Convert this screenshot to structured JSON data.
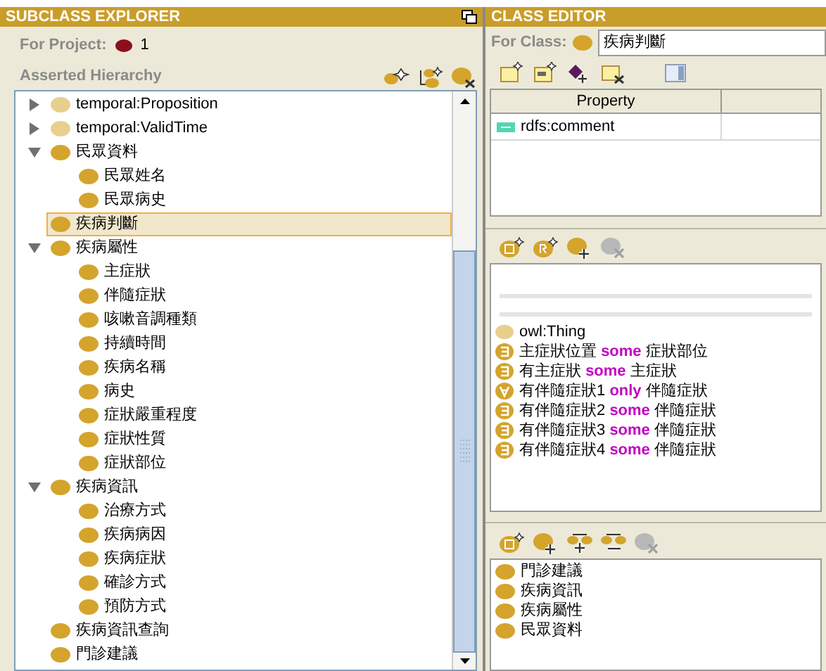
{
  "subclass_explorer": {
    "title": "SUBCLASS EXPLORER",
    "project_label": "For Project:",
    "project_value": "1",
    "hierarchy_label": "Asserted Hierarchy",
    "tree": [
      {
        "label": "temporal:Proposition",
        "color": "#e8cf8e",
        "expanded": false,
        "selected": false
      },
      {
        "label": "temporal:ValidTime",
        "color": "#e8cf8e",
        "expanded": false,
        "selected": false
      },
      {
        "label": "民眾資料",
        "color": "#d4a42c",
        "expanded": true,
        "selected": false,
        "children": [
          {
            "label": "民眾姓名",
            "color": "#d4a42c",
            "selected": false
          },
          {
            "label": "民眾病史",
            "color": "#d4a42c",
            "selected": false
          }
        ]
      },
      {
        "label": "疾病判斷",
        "color": "#d4a42c",
        "selected": true
      },
      {
        "label": "疾病屬性",
        "color": "#d4a42c",
        "expanded": true,
        "selected": false,
        "children": [
          {
            "label": "主症狀",
            "color": "#d4a42c",
            "selected": false
          },
          {
            "label": "伴隨症狀",
            "color": "#d4a42c",
            "selected": false
          },
          {
            "label": "咳嗽音調種類",
            "color": "#d4a42c",
            "selected": false
          },
          {
            "label": "持續時間",
            "color": "#d4a42c",
            "selected": false
          },
          {
            "label": "疾病名稱",
            "color": "#d4a42c",
            "selected": false
          },
          {
            "label": "病史",
            "color": "#d4a42c",
            "selected": false
          },
          {
            "label": "症狀嚴重程度",
            "color": "#d4a42c",
            "selected": false
          },
          {
            "label": "症狀性質",
            "color": "#d4a42c",
            "selected": false
          },
          {
            "label": "症狀部位",
            "color": "#d4a42c",
            "selected": false
          }
        ]
      },
      {
        "label": "疾病資訊",
        "color": "#d4a42c",
        "expanded": true,
        "selected": false,
        "children": [
          {
            "label": "治療方式",
            "color": "#d4a42c",
            "selected": false
          },
          {
            "label": "疾病病因",
            "color": "#d4a42c",
            "selected": false
          },
          {
            "label": "疾病症狀",
            "color": "#d4a42c",
            "selected": false
          },
          {
            "label": "確診方式",
            "color": "#d4a42c",
            "selected": false
          },
          {
            "label": "預防方式",
            "color": "#d4a42c",
            "selected": false
          }
        ]
      },
      {
        "label": "疾病資訊查詢",
        "color": "#d4a42c",
        "selected": false
      },
      {
        "label": "門診建議",
        "color": "#d4a42c",
        "selected": false
      }
    ]
  },
  "class_editor": {
    "title": "CLASS EDITOR",
    "class_label": "For Class:",
    "class_value": "疾病判斷",
    "table": {
      "columns": [
        "Property"
      ],
      "rows": [
        {
          "property": "rdfs:comment"
        }
      ]
    },
    "conditions": [
      {
        "kind": "class",
        "color": "#e8cf8e",
        "subject": "owl:Thing"
      },
      {
        "kind": "some",
        "color": "#d4a42c",
        "subject": "主症狀位置",
        "keyword": "some",
        "object": "症狀部位"
      },
      {
        "kind": "some",
        "color": "#d4a42c",
        "subject": "有主症狀",
        "keyword": "some",
        "object": "主症狀"
      },
      {
        "kind": "only",
        "color": "#d4a42c",
        "subject": "有伴隨症狀1",
        "keyword": "only",
        "object": "伴隨症狀"
      },
      {
        "kind": "some",
        "color": "#d4a42c",
        "subject": "有伴隨症狀2",
        "keyword": "some",
        "object": "伴隨症狀"
      },
      {
        "kind": "some",
        "color": "#d4a42c",
        "subject": "有伴隨症狀3",
        "keyword": "some",
        "object": "伴隨症狀"
      },
      {
        "kind": "some",
        "color": "#d4a42c",
        "subject": "有伴隨症狀4",
        "keyword": "some",
        "object": "伴隨症狀"
      }
    ],
    "disjoints": [
      "門診建議",
      "疾病資訊",
      "疾病屬性",
      "民眾資料"
    ]
  }
}
